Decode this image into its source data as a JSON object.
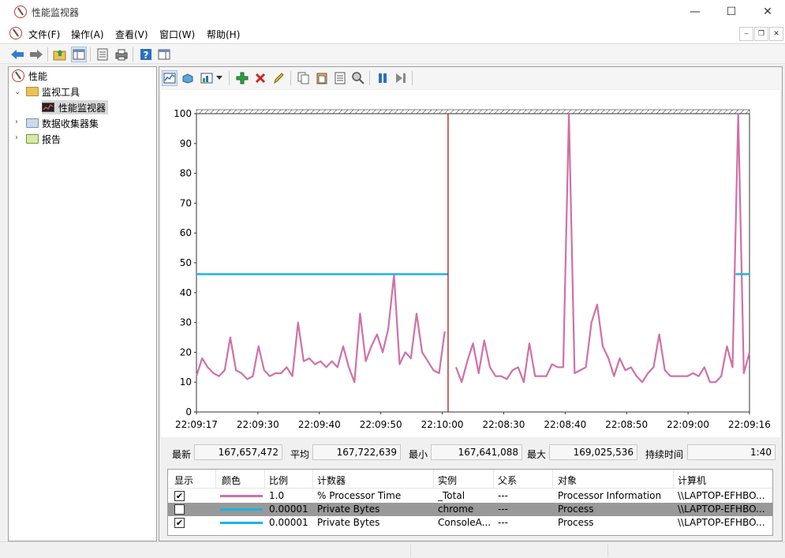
{
  "window": {
    "title": "性能监视器",
    "minimize": "—",
    "maximize": "☐",
    "close": "✕"
  },
  "menu": [
    "文件(F)",
    "操作(A)",
    "查看(V)",
    "窗口(W)",
    "帮助(H)"
  ],
  "toolbar_icons": [
    "back-icon",
    "forward-icon",
    "up-folder-icon",
    "show-hide-tree-icon",
    "properties-icon",
    "print-icon",
    "help-icon",
    "show-hide-action-pane-icon"
  ],
  "tree": {
    "root": "性能",
    "monitoring_tools": "监视工具",
    "perf_monitor": "性能监视器",
    "data_collector_sets": "数据收集器集",
    "reports": "报告"
  },
  "pm_toolbar_icons": [
    "view-graph-icon",
    "view-report-data-icon",
    "change-graph-type-icon",
    "dropdown-arrow-icon",
    "add-counter-icon",
    "delete-counter-icon",
    "highlight-icon",
    "copy-properties-icon",
    "paste-counter-list-icon",
    "properties-icon",
    "zoom-icon",
    "freeze-display-icon",
    "update-data-icon"
  ],
  "colors": {
    "pink": "#d070a8",
    "cyan": "#1cb4e4",
    "red_line": "#b00000",
    "selected_row": "#999999"
  },
  "chart_data": {
    "type": "line",
    "ylim": [
      0,
      100
    ],
    "yticks": [
      "100",
      "90",
      "80",
      "70",
      "60",
      "50",
      "40",
      "30",
      "20",
      "10",
      "0"
    ],
    "xticks": [
      "22:09:17",
      "22:09:30",
      "22:09:40",
      "22:09:50",
      "22:10:00",
      "22:08:30",
      "22:08:40",
      "22:08:50",
      "22:09:00",
      "22:09:16"
    ],
    "current_position_fraction": 0.455,
    "series": [
      {
        "name": "% Processor Time",
        "values": [
          12,
          18,
          15,
          13,
          12,
          14,
          25,
          14,
          13,
          11,
          12,
          22,
          14,
          12,
          13,
          13,
          15,
          12,
          30,
          17,
          18,
          16,
          17,
          15,
          17,
          15,
          22,
          15,
          10,
          33,
          17,
          22,
          26,
          20,
          28,
          46,
          16,
          20,
          18,
          33,
          20,
          17,
          14,
          13,
          27,
          null,
          15,
          10,
          17,
          23,
          13,
          24,
          15,
          12,
          12,
          11,
          14,
          15,
          10,
          23,
          12,
          12,
          12,
          16,
          15,
          15,
          100,
          13,
          14,
          15,
          30,
          36,
          22,
          18,
          12,
          18,
          14,
          15,
          12,
          10,
          13,
          15,
          26,
          14,
          12,
          12,
          12,
          12,
          13,
          12,
          15,
          10,
          10,
          12,
          22,
          15,
          100,
          13,
          20
        ]
      },
      {
        "name": "Private Bytes (ConsoleA…)",
        "values": [
          46.2,
          46.2
        ],
        "visible_segments": [
          [
            0,
            0.455
          ],
          [
            0.975,
            1.0
          ]
        ]
      }
    ]
  },
  "stats": {
    "last_label": "最新",
    "last": "167,657,472",
    "avg_label": "平均",
    "avg": "167,722,639",
    "min_label": "最小",
    "min": "167,641,088",
    "max_label": "最大",
    "max": "169,025,536",
    "duration_label": "持续时间",
    "duration": "1:40"
  },
  "legend": {
    "headers": [
      "显示",
      "颜色",
      "比例",
      "计数器",
      "实例",
      "父系",
      "对象",
      "计算机"
    ],
    "rows": [
      {
        "show": "✔",
        "scale": "1.0",
        "counter": "% Processor Time",
        "instance": "_Total",
        "parent": "---",
        "object": "Processor Information",
        "computer": "\\\\LAPTOP-EFHBO...",
        "color": "#d070a8"
      },
      {
        "show": "",
        "scale": "0.00001",
        "counter": "Private Bytes",
        "instance": "chrome",
        "parent": "---",
        "object": "Process",
        "computer": "\\\\LAPTOP-EFHBO...",
        "color": "#1cb4e4"
      },
      {
        "show": "✔",
        "scale": "0.00001",
        "counter": "Private Bytes",
        "instance": "ConsoleA...",
        "parent": "---",
        "object": "Process",
        "computer": "\\\\LAPTOP-EFHBO...",
        "color": "#1cb4e4"
      }
    ]
  }
}
